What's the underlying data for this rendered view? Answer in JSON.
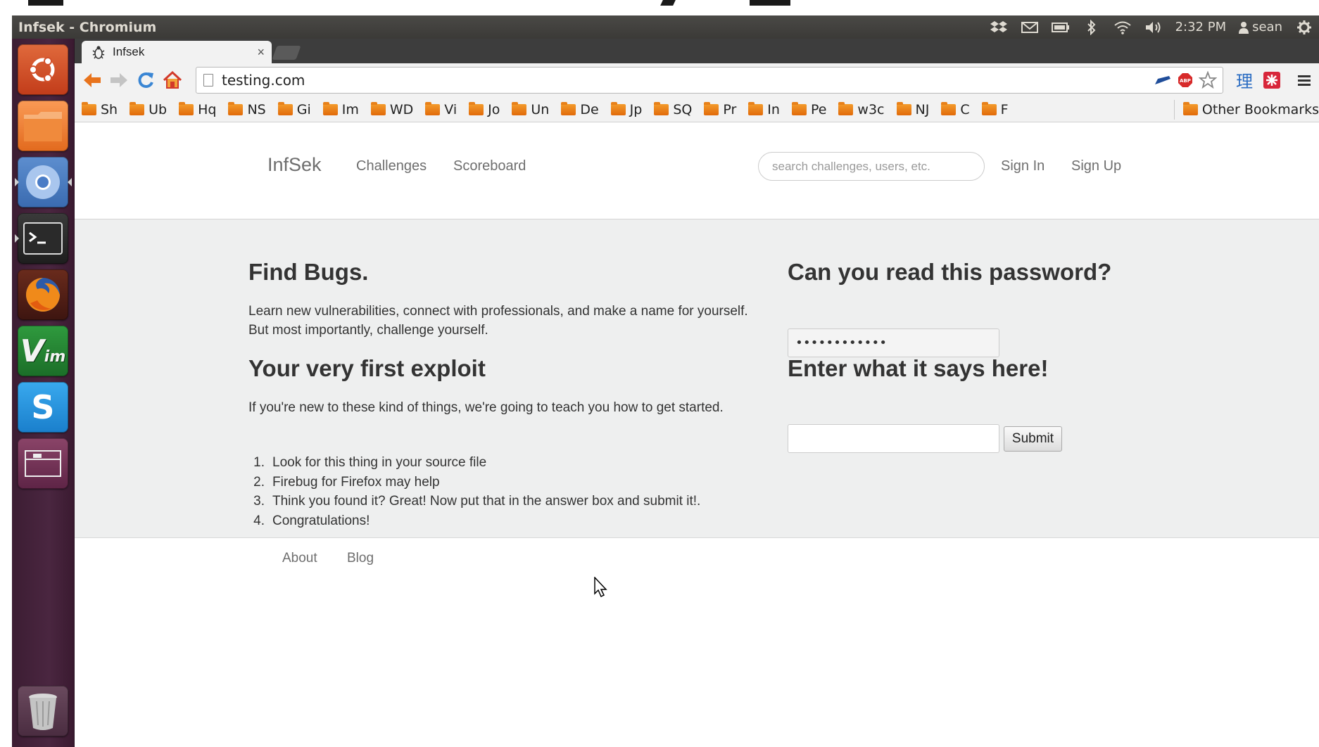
{
  "window": {
    "title": "Infsek - Chromium"
  },
  "panel": {
    "time": "2:32 PM",
    "user": "sean",
    "tray_icons": [
      "dropbox-icon",
      "mail-icon",
      "battery-icon",
      "bluetooth-icon",
      "wifi-icon",
      "volume-icon"
    ]
  },
  "launcher": {
    "items": [
      "dash-home",
      "files",
      "chromium",
      "terminal",
      "firefox",
      "vim",
      "skype",
      "workspace-switcher",
      "trash"
    ]
  },
  "browser": {
    "tab": {
      "title": "Infsek",
      "close": "×"
    },
    "url": "testing.com",
    "bookmarks": [
      "Sh",
      "Ub",
      "Hq",
      "NS",
      "Gi",
      "Im",
      "WD",
      "Vi",
      "Jo",
      "Un",
      "De",
      "Jp",
      "SQ",
      "Pr",
      "In",
      "Pe",
      "w3c",
      "NJ",
      "C",
      "F"
    ],
    "other_bookmarks": "Other Bookmarks",
    "ext_ime": "理"
  },
  "site": {
    "brand": "InfSek",
    "nav": {
      "challenges": "Challenges",
      "scoreboard": "Scoreboard",
      "sign_in": "Sign In",
      "sign_up": "Sign Up"
    },
    "search_placeholder": "search challenges, users, etc.",
    "find_bugs": {
      "title": "Find Bugs.",
      "line1": "Learn new vulnerabilities, connect with professionals, and make a name for yourself.",
      "line2": "But most importantly, challenge yourself."
    },
    "first_exploit": {
      "title": "Your very first exploit",
      "intro": "If you're new to these kind of things, we're going to teach you how to get started.",
      "steps": [
        "Look for this thing in your source file",
        "Firebug for Firefox may help",
        "Think you found it? Great! Now put that in the answer box and submit it!.",
        "Congratulations!"
      ]
    },
    "password_challenge": {
      "title": "Can you read this password?",
      "password_value": "••••••••••••",
      "enter_title": "Enter what it says here!",
      "answer_value": "",
      "submit": "Submit"
    },
    "footer": {
      "about": "About",
      "blog": "Blog"
    }
  }
}
